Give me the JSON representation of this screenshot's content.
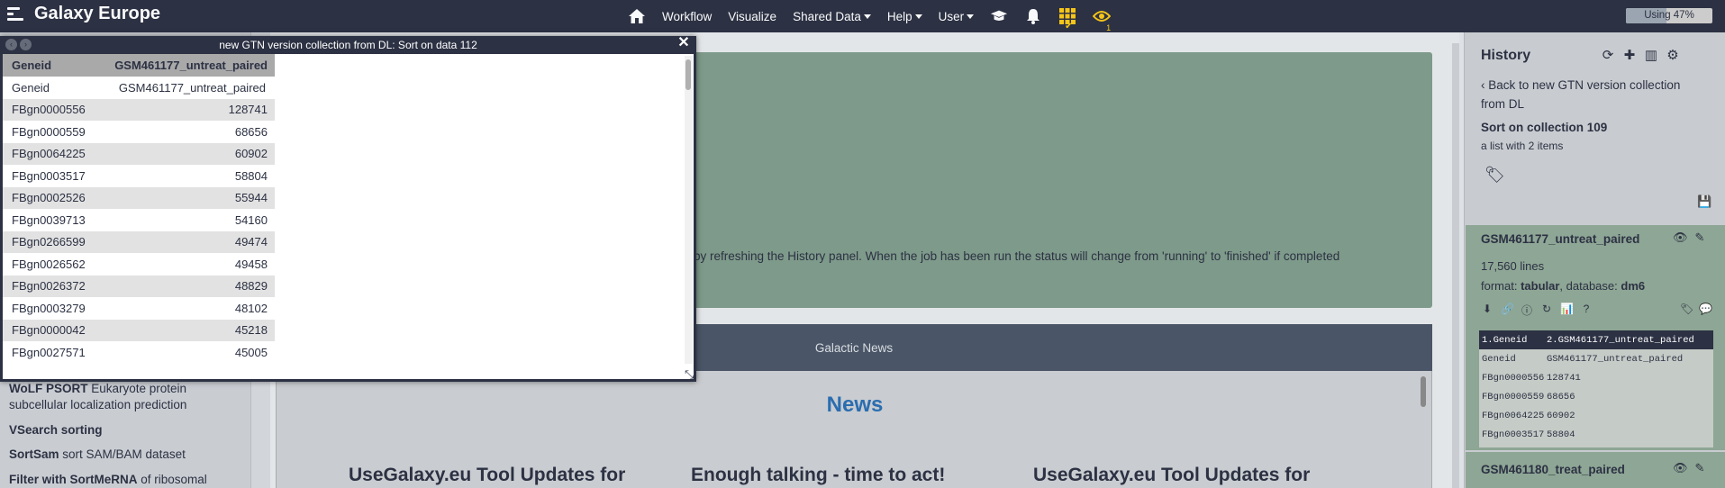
{
  "masthead": {
    "title": "Galaxy Europe",
    "nav": [
      "Workflow",
      "Visualize",
      "Shared Data",
      "Help",
      "User"
    ],
    "notification_count": "1",
    "quota_label": "Using 47%",
    "quota_percent": 47
  },
  "tools": [
    {
      "name": "WoLF PSORT",
      "desc": " Eukaryote protein"
    },
    {
      "name": "",
      "desc": "subcellular localization prediction"
    },
    {
      "name": "VSearch sorting",
      "desc": ""
    },
    {
      "name": "SortSam",
      "desc": " sort SAM/BAM dataset"
    },
    {
      "name": "Filter with SortMeRNA",
      "desc": " of ribosomal"
    }
  ],
  "center": {
    "status_text": "by refreshing the History panel. When the job has been run the status will change from 'running' to 'finished' if completed",
    "news_bar": "Galactic News",
    "news_title": "News",
    "news_cards": [
      "UseGalaxy.eu Tool Updates for",
      "Enough talking - time to act!",
      "UseGalaxy.eu Tool Updates for"
    ]
  },
  "history": {
    "title": "History",
    "back_link": "Back to new GTN version collection from DL",
    "collection_name": "Sort on collection 109",
    "collection_sub": "a list with 2 items",
    "dataset1": {
      "name": "GSM461177_untreat_paired",
      "lines": "17,560 lines",
      "format_label": "format: ",
      "format": "tabular",
      "db_label": ", database: ",
      "db": "dm6",
      "peek_header": [
        "1.Geneid",
        "2.GSM461177_untreat_paired"
      ],
      "peek_rows": [
        [
          "Geneid",
          "GSM461177_untreat_paired"
        ],
        [
          "FBgn0000556",
          "128741"
        ],
        [
          "FBgn0000559",
          "68656"
        ],
        [
          "FBgn0064225",
          "60902"
        ],
        [
          "FBgn0003517",
          "58804"
        ]
      ]
    },
    "dataset2": {
      "name": "GSM461180_treat_paired"
    }
  },
  "modal": {
    "title": "new GTN version collection from DL: Sort on data 112",
    "columns": [
      "Geneid",
      "GSM461177_untreat_paired"
    ],
    "rows": [
      [
        "Geneid",
        "GSM461177_untreat_paired"
      ],
      [
        "FBgn0000556",
        "128741"
      ],
      [
        "FBgn0000559",
        "68656"
      ],
      [
        "FBgn0064225",
        "60902"
      ],
      [
        "FBgn0003517",
        "58804"
      ],
      [
        "FBgn0002526",
        "55944"
      ],
      [
        "FBgn0039713",
        "54160"
      ],
      [
        "FBgn0266599",
        "49474"
      ],
      [
        "FBgn0026562",
        "49458"
      ],
      [
        "FBgn0026372",
        "48829"
      ],
      [
        "FBgn0003279",
        "48102"
      ],
      [
        "FBgn0000042",
        "45218"
      ],
      [
        "FBgn0027571",
        "45005"
      ]
    ]
  }
}
